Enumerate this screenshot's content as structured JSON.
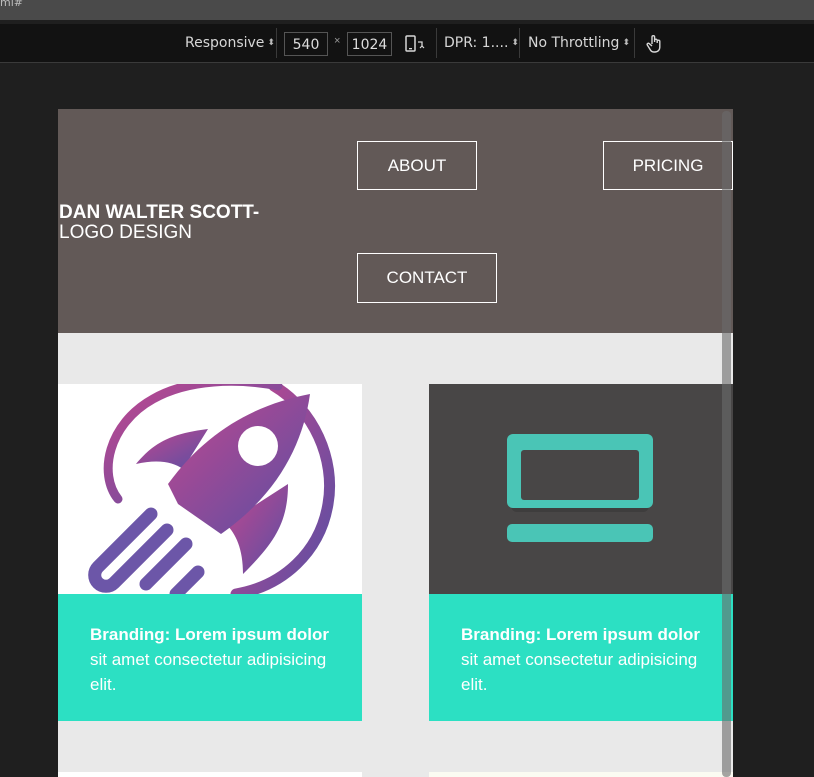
{
  "devtools": {
    "crumb": "ml#",
    "device": "Responsive",
    "width": "540",
    "times": "×",
    "height": "1024",
    "dpr": "DPR: 1....",
    "throttling": "No Throttling",
    "colors": {
      "bar": "#121212",
      "text": "#d7d7d7"
    }
  },
  "site": {
    "logo_bold": "DAN WALTER SCOTT-",
    "logo_rest": " LOGO DESIGN",
    "nav": {
      "about": "ABOUT",
      "pricing": "PRICING",
      "contact": "CONTACT"
    },
    "colors": {
      "header": "#625957",
      "accent": "#2ce0c3",
      "page": "#e9e9e9",
      "dark_tile": "#484646",
      "laptop": "#4ac5b6"
    },
    "cards": [
      {
        "icon": "rocket-icon",
        "bold": "Branding: Lorem ipsum dolor",
        "text": " sit amet consectetur adipisicing elit."
      },
      {
        "icon": "laptop-icon",
        "bold": "Branding: Lorem ipsum dolor",
        "text": " sit amet consectetur adipisicing elit."
      }
    ]
  }
}
